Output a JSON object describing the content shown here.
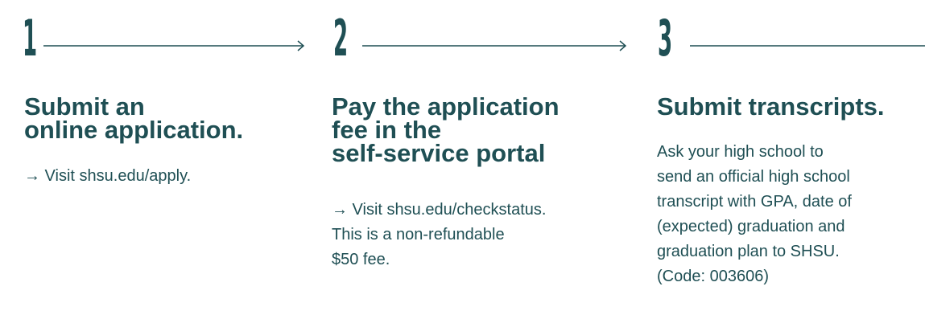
{
  "colors": {
    "text": "#1f4f54",
    "background": "#ffffff"
  },
  "steps": [
    {
      "number": "1",
      "connector": "arrow-right",
      "heading": "Submit an\nonline application.",
      "body": "→ Visit shsu.edu/apply."
    },
    {
      "number": "2",
      "connector": "arrow-right",
      "heading": "Pay the application\nfee in the\nself-service portal",
      "body": "→ Visit shsu.edu/checkstatus.\nThis is a non-refundable\n$50 fee."
    },
    {
      "number": "3",
      "connector": "line",
      "heading": "Submit transcripts.",
      "body": "Ask your high school to\nsend an official high school\ntranscript with GPA, date of\n(expected) graduation and\ngraduation plan to SHSU.\n(Code: 003606)"
    }
  ]
}
